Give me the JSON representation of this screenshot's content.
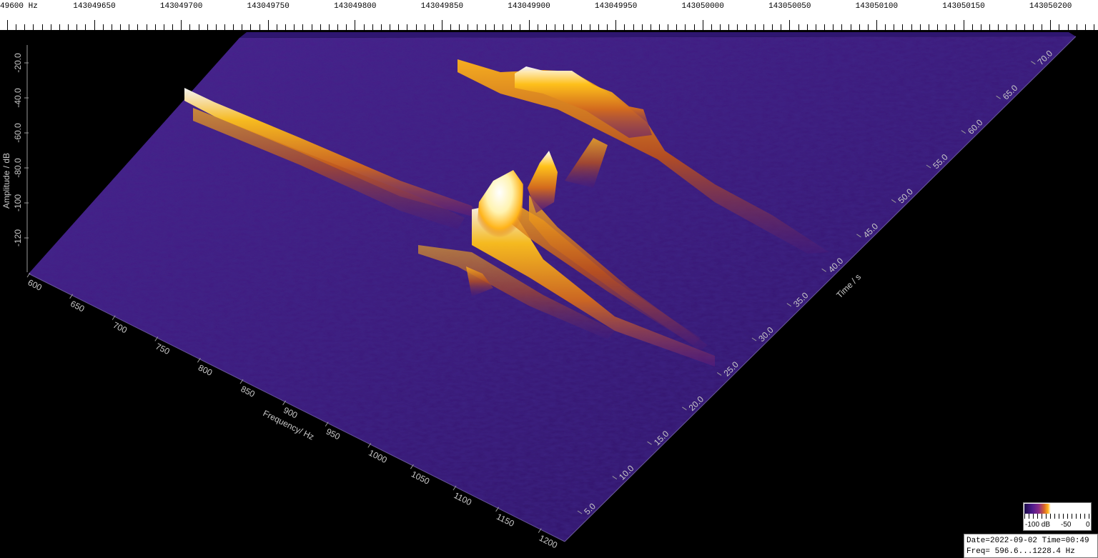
{
  "top_scale": {
    "unit": "Hz",
    "first_label": "49600",
    "labels": [
      "143049650",
      "143049700",
      "143049750",
      "143049800",
      "143049850",
      "143049900",
      "143049950",
      "143050000",
      "143050050",
      "143050100",
      "143050150",
      "143050200"
    ]
  },
  "axes": {
    "amplitude_title": "Amplitude / dB",
    "amplitude_ticks": [
      "-20.0",
      "-40.0",
      "-60.0",
      "-80.0",
      "-100",
      "-120"
    ],
    "frequency_title": "Frequency/ Hz",
    "frequency_ticks": [
      "600",
      "650",
      "700",
      "750",
      "800",
      "850",
      "900",
      "950",
      "1000",
      "1050",
      "1100",
      "1150",
      "1200"
    ],
    "time_title": "Time / s",
    "time_ticks": [
      "5.0",
      "10.0",
      "15.0",
      "20.0",
      "25.0",
      "30.0",
      "35.0",
      "40.0",
      "45.0",
      "50.0",
      "55.0",
      "60.0",
      "65.0",
      "70.0"
    ]
  },
  "colorbar": {
    "low_label": "-100 dB",
    "mid_label": "-50",
    "high_label": "0"
  },
  "info": {
    "date_line": "Date=2022-09-02 Time=00:49",
    "freq_line": "Freq= 596.6...1228.4 Hz"
  },
  "colors": {
    "background": "#000000",
    "noise_floor": "#3b1a78",
    "signal_mid": "#d2691e",
    "signal_high": "#ffc21a",
    "signal_peak": "#ffffff",
    "axis_text": "#c8c8c8"
  }
}
